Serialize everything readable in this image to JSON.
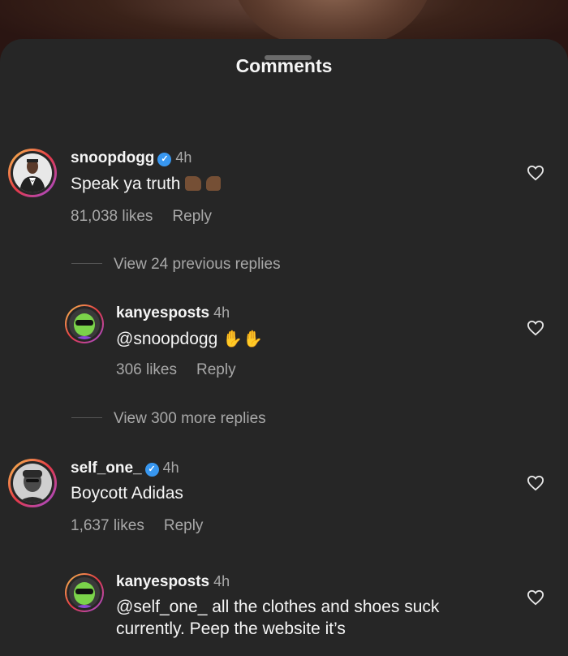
{
  "header": {
    "title": "Comments"
  },
  "comments": [
    {
      "user": "snoopdogg",
      "verified": true,
      "time": "4h",
      "text": "Speak ya truth",
      "emoji": "👍💪",
      "likes": "81,038 likes",
      "reply": "Reply"
    },
    {
      "user": "kanyesposts",
      "verified": false,
      "time": "4h",
      "text": "@snoopdogg",
      "emoji": "👏👏",
      "likes": "306 likes",
      "reply": "Reply"
    },
    {
      "user": "self_one_",
      "verified": true,
      "time": "4h",
      "text": "Boycott Adidas",
      "likes": "1,637 likes",
      "reply": "Reply"
    },
    {
      "user": "kanyesposts",
      "verified": false,
      "time": "4h",
      "text_line1": "@self_one_ all the clothes and shoes suck",
      "text_line2": "currently. Peep the website it’s"
    }
  ],
  "threads": {
    "view_previous": "View 24 previous replies",
    "view_more": "View 300 more replies"
  },
  "icons": {
    "heart": "heart-icon",
    "verified": "verified-badge-icon"
  },
  "colors": {
    "sheet": "#262626",
    "verified": "#3897f0",
    "muted": "#a8a8a8"
  }
}
